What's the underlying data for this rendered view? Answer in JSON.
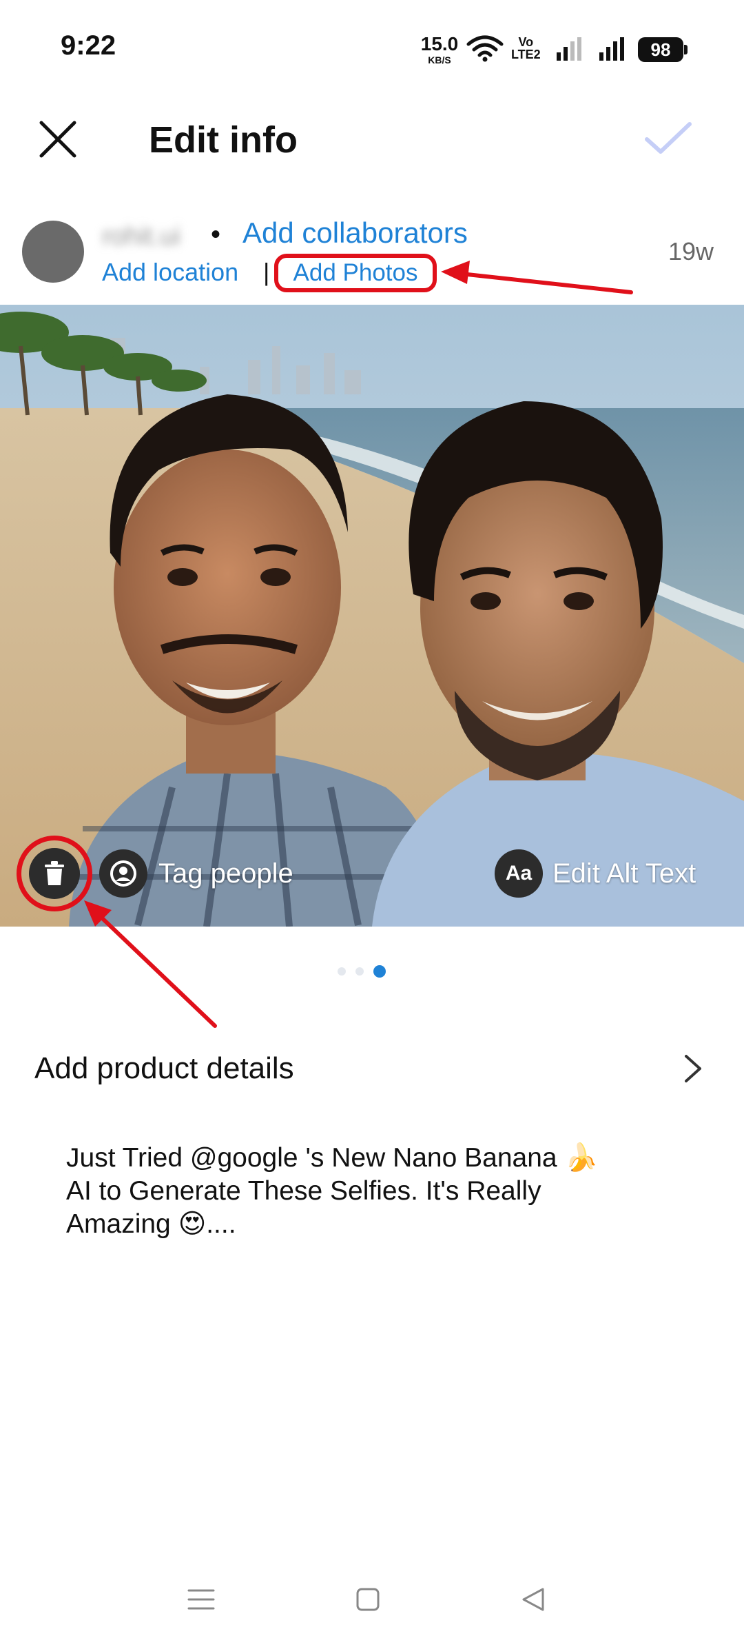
{
  "status_bar": {
    "time": "9:22",
    "net_speed_value": "15.0",
    "net_speed_unit": "KB/S",
    "volte_top": "Vo",
    "volte_bottom": "LTE2",
    "battery": "98"
  },
  "header": {
    "title": "Edit info",
    "close_icon": "close-icon",
    "confirm_icon": "check-icon"
  },
  "post": {
    "username": "rohit.ui",
    "separator": "•",
    "add_collaborators": "Add collaborators",
    "add_location": "Add location",
    "pipe": "|",
    "add_photos": "Add Photos",
    "timestamp": "19w"
  },
  "photo_overlay": {
    "tag_people": "Tag people",
    "alt_icon_text": "Aa",
    "edit_alt_text": "Edit Alt Text"
  },
  "pager": {
    "count": 3,
    "active": 3
  },
  "product": {
    "label": "Add product details"
  },
  "caption": {
    "line1": "Just Tried @google 's New Nano Banana 🍌",
    "line2": "AI to Generate These Selfies. It's Really",
    "line3": "Amazing 😍...."
  },
  "colors": {
    "link": "#1f82d6",
    "annotation": "#e0101a",
    "confirm_check": "#c5cef7"
  }
}
